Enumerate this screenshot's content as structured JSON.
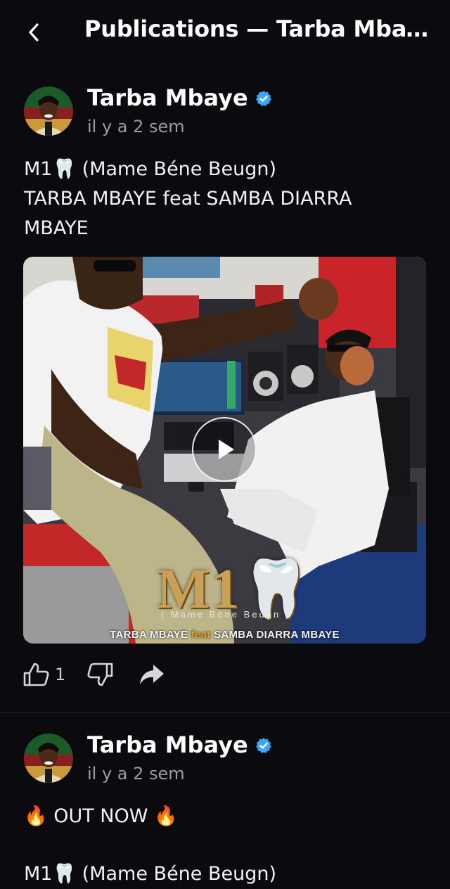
{
  "topbar": {
    "title": "Publications — Tarba Mbaye",
    "back_icon": "chevron-left-icon"
  },
  "posts": [
    {
      "author": "Tarba Mbaye",
      "verified_icon": "verified-badge-icon",
      "time": "il y a 2 sem",
      "text_lines": [
        "M1🦷 (Mame Béne Beugn)",
        "TARBA MBAYE feat SAMBA DIARRA",
        "MBAYE"
      ],
      "media": {
        "title": "M1🦷",
        "subtitle": "( Mame Bène Beugn )",
        "caption_a": "TARBA MBAYE ",
        "caption_feat": "feat",
        "caption_b": " SAMBA DIARRA MBAYE",
        "play_icon": "play-icon"
      },
      "likes": "1",
      "like_icon": "thumbs-up-icon",
      "dislike_icon": "thumbs-down-icon",
      "share_icon": "share-icon"
    },
    {
      "author": "Tarba Mbaye",
      "verified_icon": "verified-badge-icon",
      "time": "il y a 2 sem",
      "text_lines": [
        "🔥 OUT NOW 🔥",
        "",
        "M1🦷 (Mame Béne Beugn)"
      ]
    }
  ],
  "colors": {
    "background": "#0b0b0f",
    "verified": "#3ea6ff",
    "muted_text": "#9a9aa0",
    "divider": "#26262c"
  }
}
